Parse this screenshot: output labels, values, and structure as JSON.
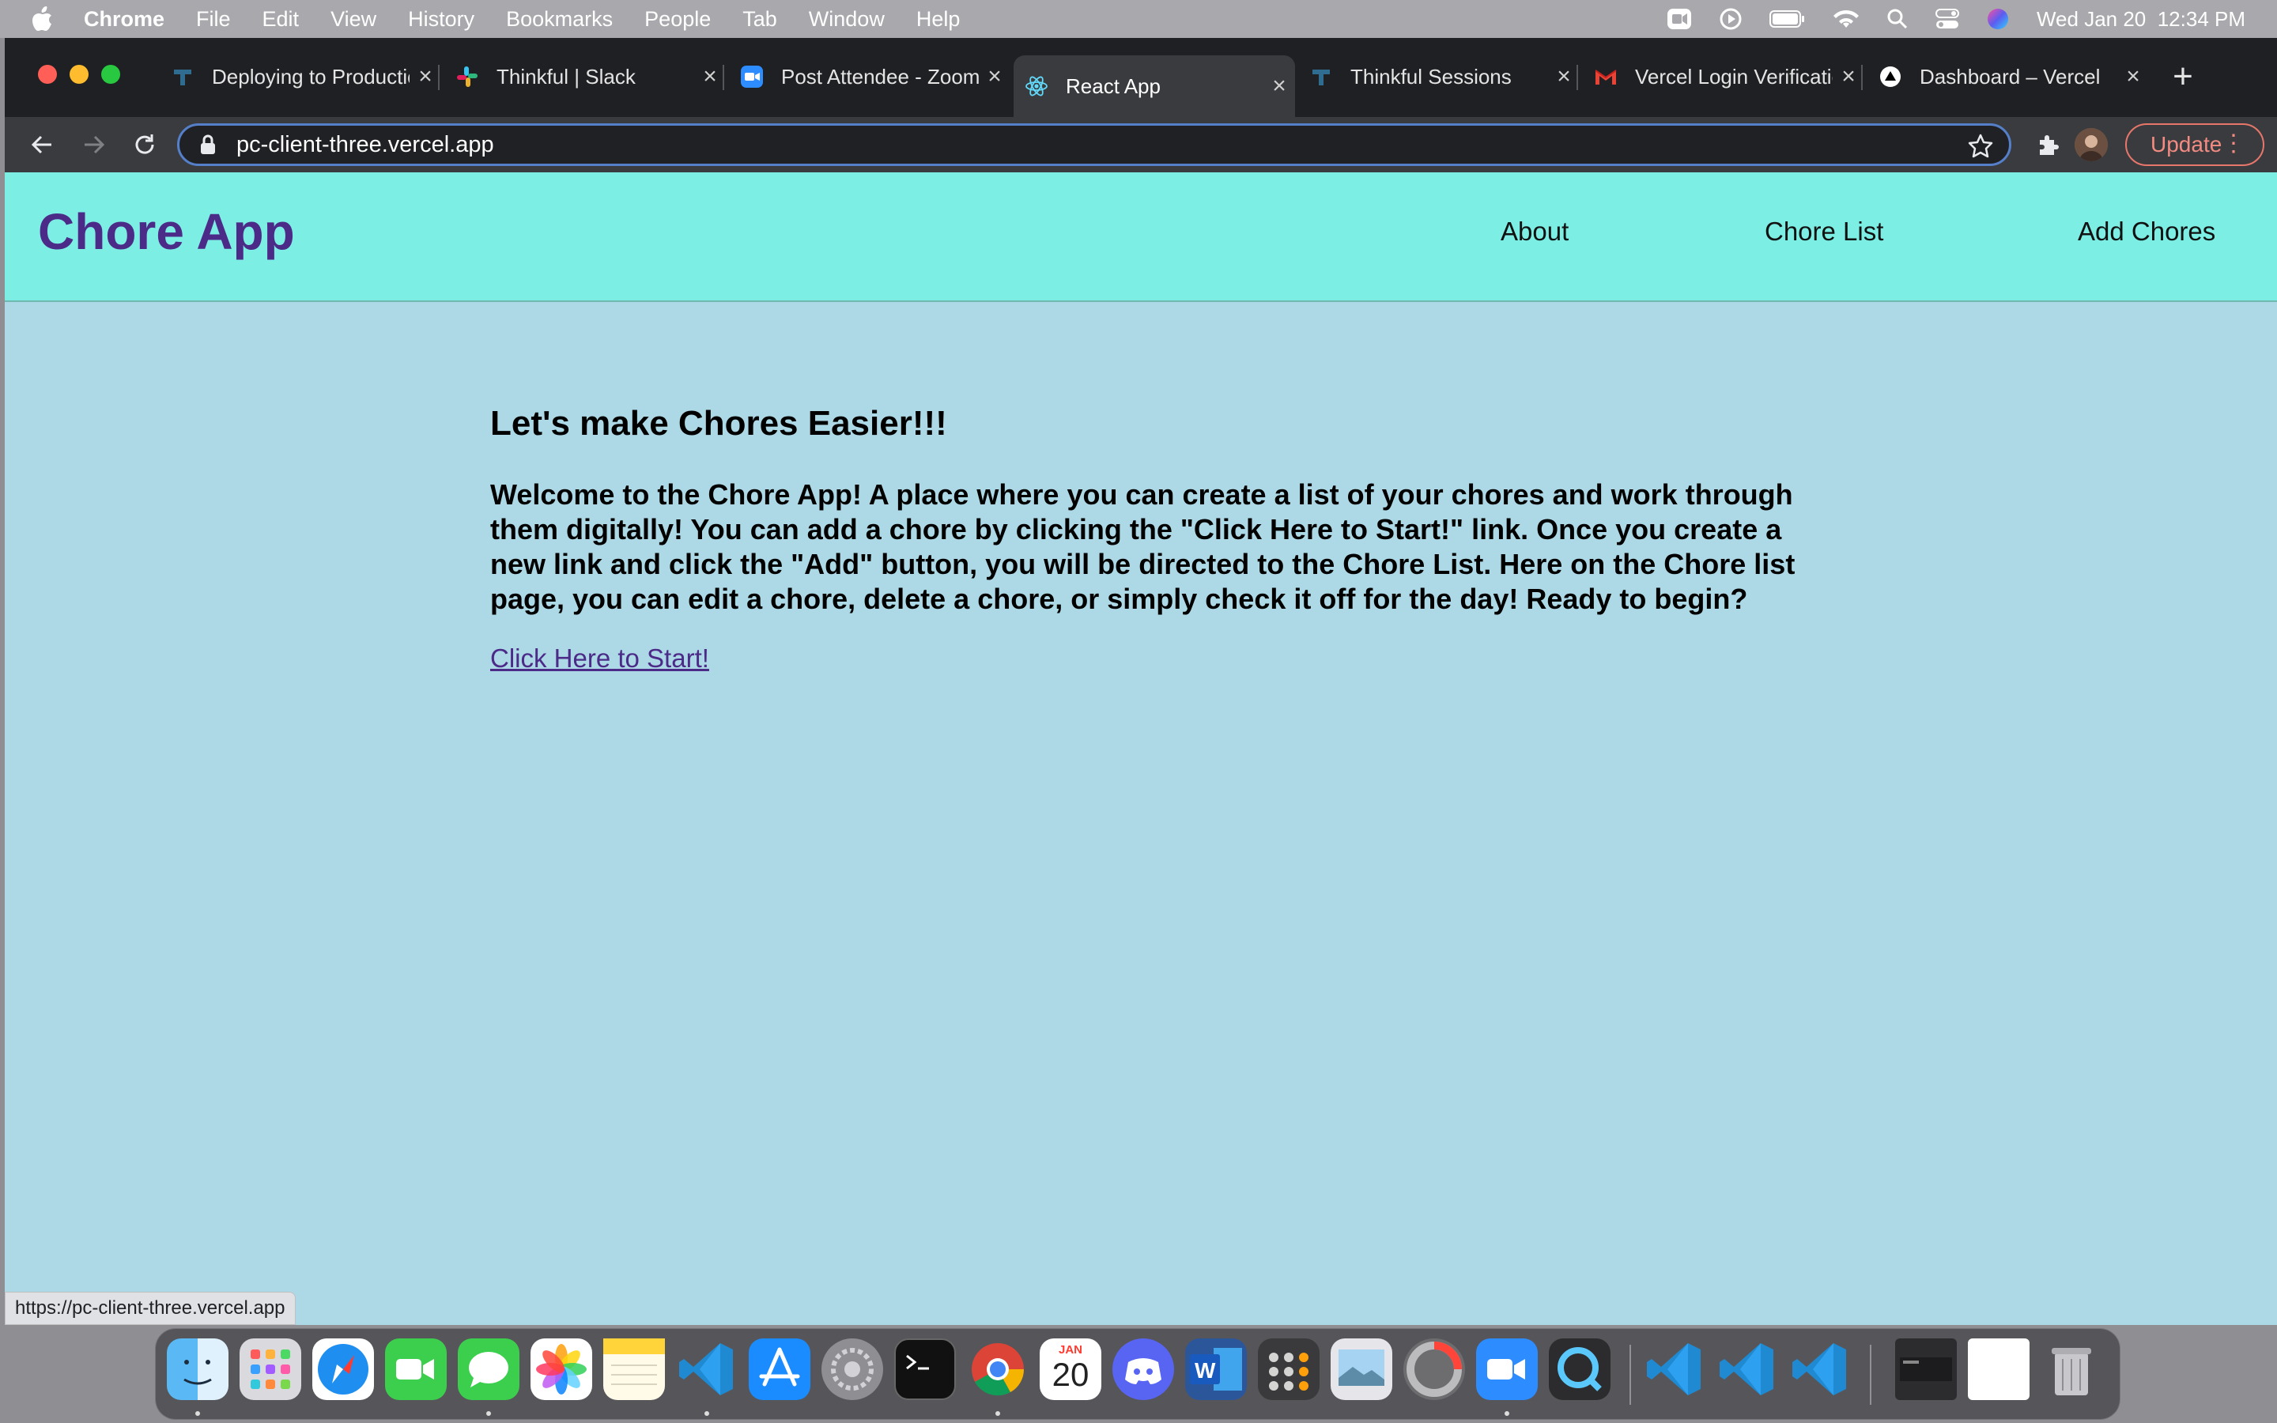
{
  "menubar": {
    "apple_glyph": "",
    "app_name": "Chrome",
    "items": [
      "File",
      "Edit",
      "View",
      "History",
      "Bookmarks",
      "People",
      "Tab",
      "Window",
      "Help"
    ],
    "clock": "Wed Jan 20  12:34 PM",
    "status_icons": [
      "screen-record-icon",
      "play-circle-icon",
      "battery-icon",
      "wifi-icon",
      "spotlight-icon",
      "control-center-icon",
      "siri-icon"
    ]
  },
  "tabs": [
    {
      "title": "Deploying to Production",
      "icon": "thinkful-icon"
    },
    {
      "title": "Thinkful | Slack",
      "icon": "slack-icon"
    },
    {
      "title": "Post Attendee - Zoom",
      "icon": "zoom-icon"
    },
    {
      "title": "React App",
      "icon": "react-icon",
      "active": true
    },
    {
      "title": "Thinkful Sessions",
      "icon": "thinkful-icon"
    },
    {
      "title": "Vercel Login Verification",
      "icon": "gmail-icon"
    },
    {
      "title": "Dashboard – Vercel",
      "icon": "vercel-icon"
    }
  ],
  "toolbar": {
    "url": "pc-client-three.vercel.app",
    "update_label": "Update"
  },
  "page": {
    "brand": "Chore App",
    "nav": [
      "About",
      "Chore List",
      "Add Chores"
    ],
    "headline": "Let's make Chores Easier!!!",
    "welcome": "Welcome to the Chore App! A place where you can create a list of your chores and work through them digitally! You can add a chore by clicking the \"Click Here to Start!\" link. Once you create a new link and click the \"Add\" button, you will be directed to the Chore List. Here on the Chore list page, you can edit a chore, delete a chore, or simply check it off for the day! Ready to begin?",
    "start_link": "Click Here to Start!",
    "status_url": "https://pc-client-three.vercel.app"
  },
  "dock": {
    "calendar_month": "JAN",
    "calendar_day": "20",
    "apps": [
      "finder-icon",
      "launchpad-icon",
      "safari-icon",
      "facetime-icon",
      "messages-icon",
      "photos-icon",
      "notes-icon",
      "vscode-icon",
      "app-store-icon",
      "system-preferences-icon",
      "terminal-icon",
      "chrome-icon",
      "calendar-icon",
      "discord-icon",
      "word-icon",
      "calculator-icon",
      "preview-icon",
      "disk-utility-icon",
      "zoom-icon",
      "quicktime-icon"
    ],
    "recent": [
      "vscode-icon",
      "vscode-icon",
      "vscode-icon"
    ],
    "extra": [
      "window-thumbnail-icon",
      "chrome-window-thumbnail-icon",
      "trash-icon"
    ]
  },
  "colors": {
    "header_bg": "#7ceee4",
    "page_bg": "#add8e6",
    "brand": "#4b2a88",
    "link": "#4b2a88",
    "update_border": "#e7776b"
  }
}
